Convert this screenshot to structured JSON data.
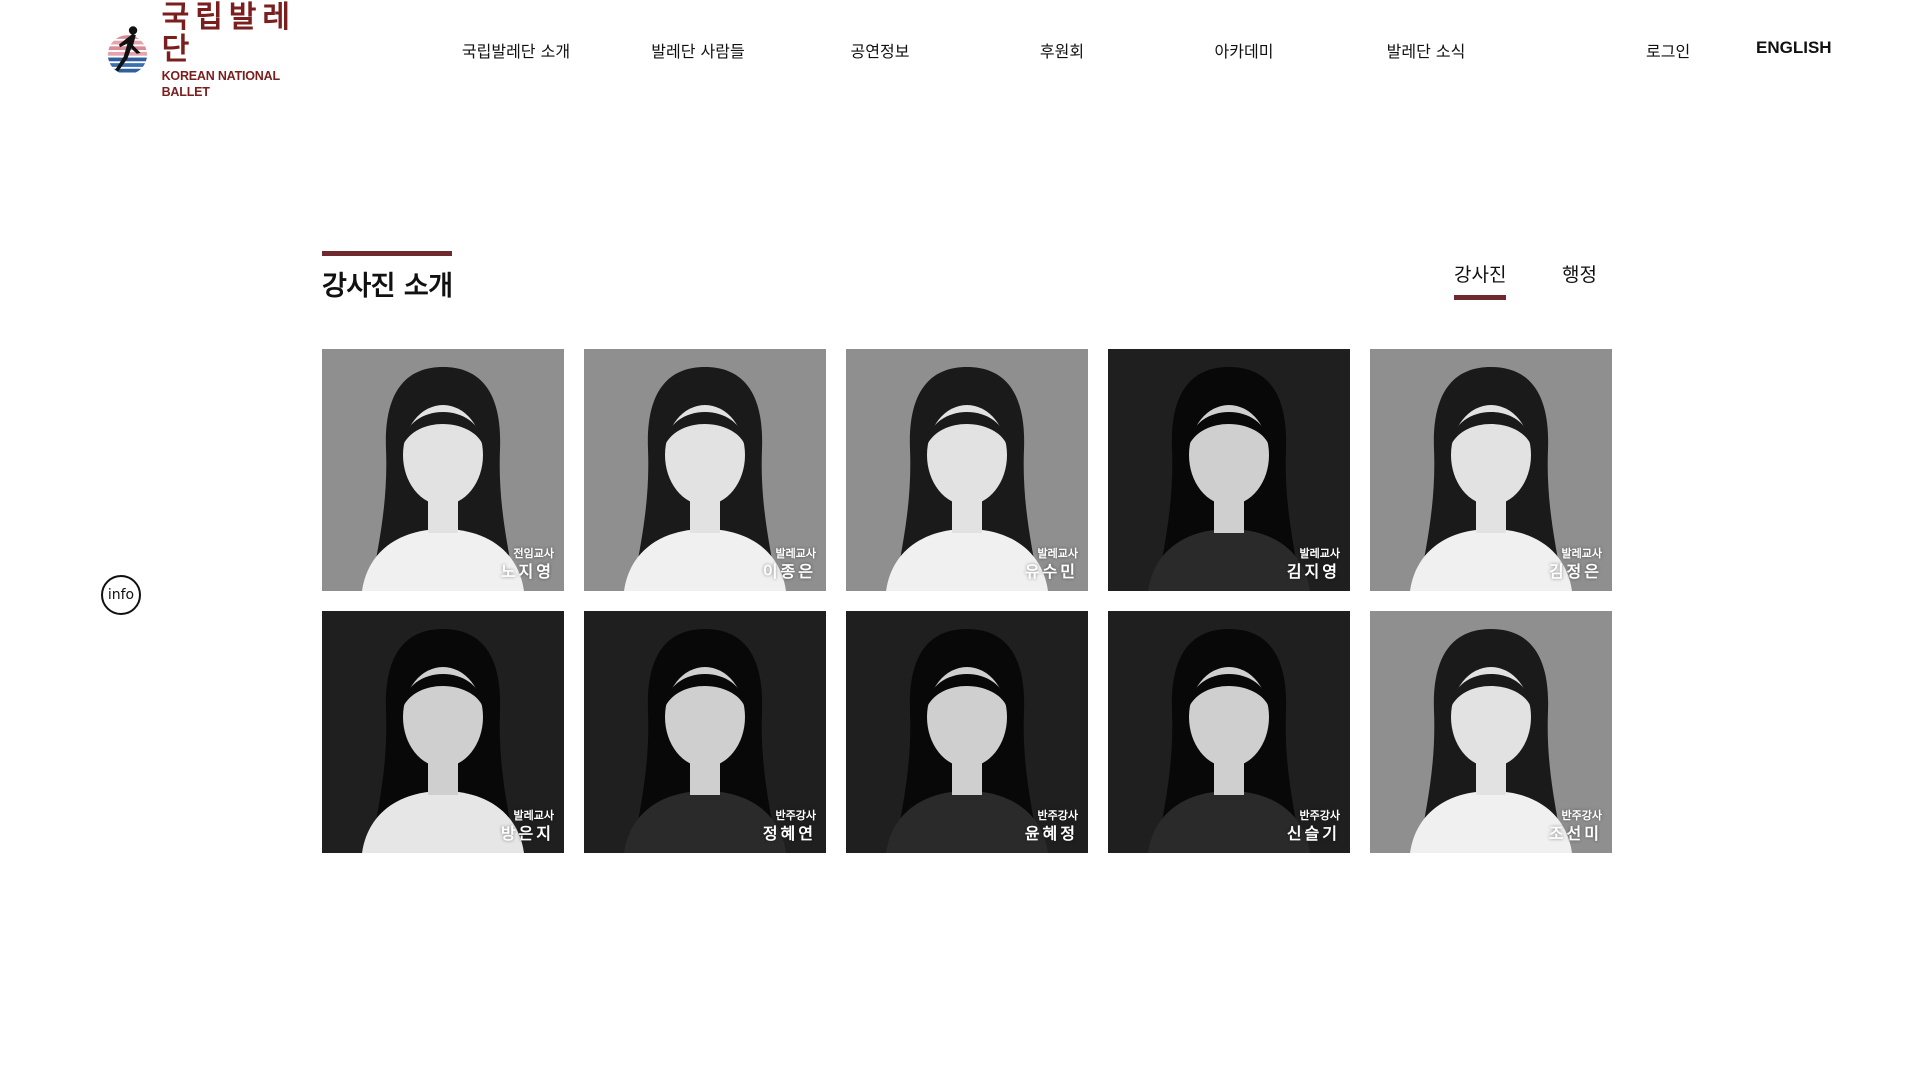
{
  "header": {
    "logo": {
      "korean": "국립발레단",
      "english": "KOREAN NATIONAL BALLET"
    },
    "nav": [
      {
        "label": "국립발레단 소개"
      },
      {
        "label": "발레단 사람들"
      },
      {
        "label": "공연정보"
      },
      {
        "label": "후원회"
      },
      {
        "label": "아카데미"
      },
      {
        "label": "발레단 소식"
      }
    ],
    "utility": {
      "login": "로그인",
      "english": "ENGLISH"
    }
  },
  "section": {
    "title": "강사진 소개",
    "tabs": [
      {
        "label": "강사진",
        "active": true
      },
      {
        "label": "행정",
        "active": false
      }
    ]
  },
  "instructors": [
    {
      "role": "전임교사",
      "name": "노지영",
      "tone": "light"
    },
    {
      "role": "발레교사",
      "name": "이종은",
      "tone": "light"
    },
    {
      "role": "발레교사",
      "name": "유수민",
      "tone": "light"
    },
    {
      "role": "발레교사",
      "name": "김지영",
      "tone": "dark"
    },
    {
      "role": "발레교사",
      "name": "김정은",
      "tone": "light"
    },
    {
      "role": "발레교사",
      "name": "방은지",
      "tone": "dark"
    },
    {
      "role": "반주강사",
      "name": "정혜연",
      "tone": "dark"
    },
    {
      "role": "반주강사",
      "name": "윤혜정",
      "tone": "dark"
    },
    {
      "role": "반주강사",
      "name": "신슬기",
      "tone": "dark"
    },
    {
      "role": "반주강사",
      "name": "조선미",
      "tone": "light"
    }
  ],
  "info_button": {
    "label": "info"
  },
  "colors": {
    "accent": "#6e2a2e",
    "brand": "#7a1e1e",
    "text": "#111111",
    "background": "#ffffff"
  }
}
